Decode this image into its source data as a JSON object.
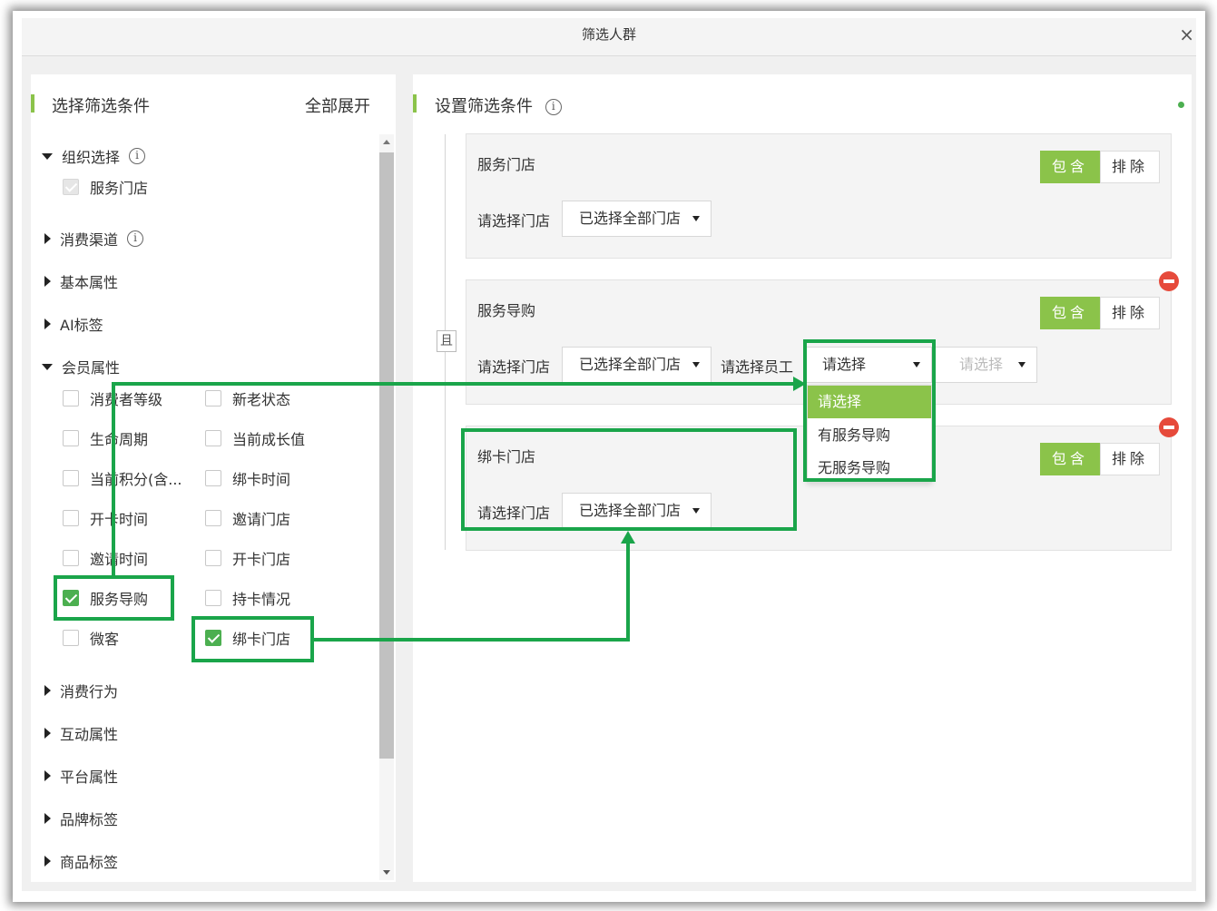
{
  "dialog": {
    "title": "筛选人群",
    "close": "×"
  },
  "left": {
    "header": "选择筛选条件",
    "expand_all": "全部展开",
    "groups": [
      {
        "label": "组织选择",
        "expanded": true
      },
      {
        "label": "消费渠道",
        "expanded": false
      },
      {
        "label": "基本属性",
        "expanded": false
      },
      {
        "label": "AI标签",
        "expanded": false
      },
      {
        "label": "会员属性",
        "expanded": true
      },
      {
        "label": "消费行为",
        "expanded": false
      },
      {
        "label": "互动属性",
        "expanded": false
      },
      {
        "label": "平台属性",
        "expanded": false
      },
      {
        "label": "品牌标签",
        "expanded": false
      },
      {
        "label": "商品标签",
        "expanded": false
      }
    ],
    "org_items": [
      {
        "label": "服务门店",
        "state": "disabled-checked"
      }
    ],
    "member_items": [
      {
        "label": "消费者等级",
        "checked": false
      },
      {
        "label": "新老状态",
        "checked": false
      },
      {
        "label": "生命周期",
        "checked": false
      },
      {
        "label": "当前成长值",
        "checked": false
      },
      {
        "label": "当前积分(含...",
        "checked": false
      },
      {
        "label": "绑卡时间",
        "checked": false
      },
      {
        "label": "开卡时间",
        "checked": false
      },
      {
        "label": "邀请门店",
        "checked": false
      },
      {
        "label": "邀请时间",
        "checked": false
      },
      {
        "label": "开卡门店",
        "checked": false
      },
      {
        "label": "服务导购",
        "checked": true
      },
      {
        "label": "持卡情况",
        "checked": false
      },
      {
        "label": "微客",
        "checked": false
      },
      {
        "label": "绑卡门店",
        "checked": true
      }
    ]
  },
  "right": {
    "header": "设置筛选条件",
    "and_label": "且",
    "cards": [
      {
        "title": "服务门店",
        "store_label": "请选择门店",
        "store_value": "已选择全部门店",
        "include": "包含",
        "exclude": "排除"
      },
      {
        "title": "服务导购",
        "store_label": "请选择门店",
        "store_value": "已选择全部门店",
        "staff_label": "请选择员工",
        "staff_value": "请选择",
        "staff_sub": "请选择",
        "include": "包含",
        "exclude": "排除"
      },
      {
        "title": "绑卡门店",
        "store_label": "请选择门店",
        "store_value": "已选择全部门店",
        "include": "包含",
        "exclude": "排除"
      }
    ],
    "dropdown_options": [
      "请选择",
      "有服务导购",
      "无服务导购"
    ]
  },
  "colors": {
    "accent": "#8bc34a",
    "highlight": "#1aa54a",
    "remove": "#e64a3b"
  }
}
